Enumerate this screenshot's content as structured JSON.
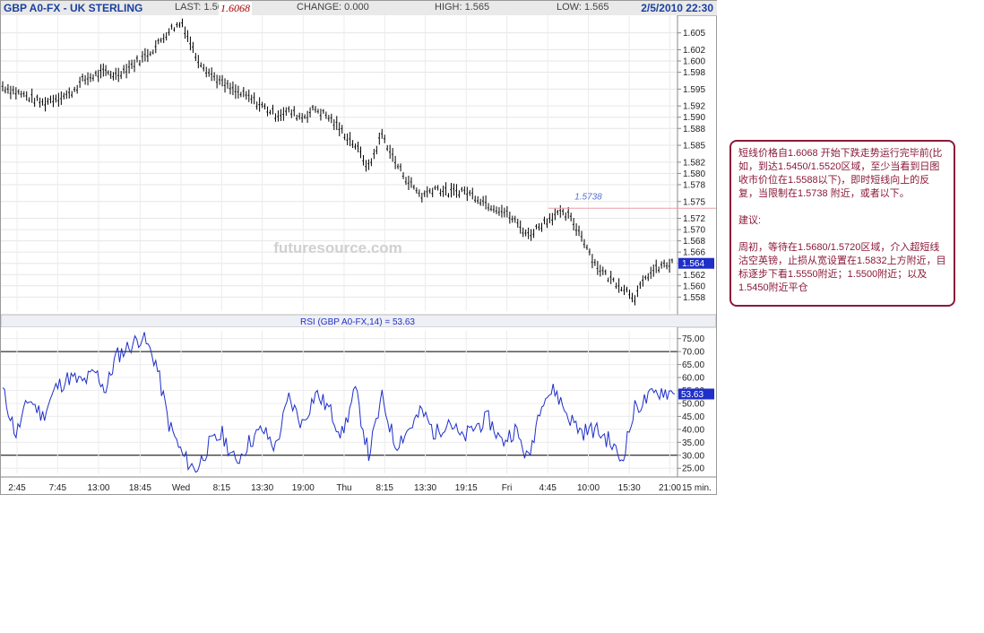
{
  "header": {
    "title": "GBP A0-FX - UK STERLING",
    "last_label": "LAST: 1.56",
    "last_annotation": "1.6068",
    "change_label": "CHANGE: 0.000",
    "high_label": "HIGH: 1.565",
    "low_label": "LOW: 1.565",
    "datetime": "2/5/2010 22:30"
  },
  "watermark": "futuresource.com",
  "price_annotation": "1.5738",
  "last_price_tag": "1.564",
  "rsi_label": "RSI (GBP A0-FX,14) = 53.63",
  "rsi_value_tag": "53.63",
  "interval_label": "15 min.",
  "annotation": {
    "line1": "短线价格自1.6068 开始下跌走势运行完毕前(比如，到达1.5450/1.5520区域，至少当看到日图收市价位在1.5588以下)，即时短线向上的反复，当限制在1.5738 附近，或者以下。",
    "line2": "建议:",
    "line3": "周初，等待在1.5680/1.5720区域，介入超短线沽空英镑，止损从宽设置在1.5832上方附近，目标逐步下看1.5550附近；1.5500附近；以及1.5450附近平仓"
  },
  "colors": {
    "price_bars": "#000000",
    "rsi_line": "#1f2fc8",
    "annotation_border": "#8b1a3a",
    "tag_background": "#1f2fc8"
  },
  "chart_data": [
    {
      "type": "line",
      "title": "GBP A0-FX - UK STERLING",
      "series": [
        {
          "x_index": [
            0,
            4,
            8,
            12,
            16,
            20,
            24,
            28,
            31,
            34,
            38,
            42,
            46,
            50,
            54,
            58,
            62,
            66,
            70,
            74,
            78,
            82,
            86,
            90,
            94,
            98,
            102,
            106,
            110,
            114,
            118,
            122,
            126,
            130,
            134,
            138,
            142,
            146,
            150,
            154,
            158,
            162,
            166,
            170,
            174,
            178,
            182,
            186,
            190,
            194,
            198,
            202
          ],
          "values": [
            1.5955,
            1.5945,
            1.5935,
            1.5925,
            1.5935,
            1.594,
            1.5965,
            1.5975,
            1.598,
            1.5975,
            1.599,
            1.6005,
            1.6025,
            1.6055,
            1.6068,
            1.601,
            1.598,
            1.596,
            1.5945,
            1.5935,
            1.592,
            1.5905,
            1.591,
            1.59,
            1.5915,
            1.59,
            1.5875,
            1.585,
            1.581,
            1.587,
            1.582,
            1.5785,
            1.576,
            1.5775,
            1.5765,
            1.577,
            1.576,
            1.5745,
            1.5735,
            1.5715,
            1.569,
            1.571,
            1.5728,
            1.5725,
            1.569,
            1.564,
            1.5615,
            1.56,
            1.558,
            1.562,
            1.5635,
            1.564
          ]
        }
      ],
      "ylim": [
        1.5555,
        1.6075
      ],
      "y_ticks": [
        1.558,
        1.56,
        1.562,
        1.564,
        1.566,
        1.568,
        1.57,
        1.572,
        1.575,
        1.578,
        1.58,
        1.582,
        1.585,
        1.588,
        1.59,
        1.592,
        1.595,
        1.598,
        1.6,
        1.602,
        1.605
      ],
      "y_tick_labels": [
        "1.558",
        "1.560",
        "1.562",
        "1.564",
        "1.566",
        "1.568",
        "1.570",
        "1.572",
        "1.575",
        "1.578",
        "1.580",
        "1.582",
        "1.585",
        "1.588",
        "1.590",
        "1.592",
        "1.595",
        "1.598",
        "1.600",
        "1.602",
        "1.605"
      ],
      "x_tick_labels": [
        "2:45",
        "7:45",
        "13:00",
        "18:45",
        "Wed",
        "8:15",
        "13:30",
        "19:00",
        "Thu",
        "8:15",
        "13:30",
        "19:15",
        "Fri",
        "4:45",
        "10:00",
        "15:30",
        "21:00"
      ],
      "reference_line": 1.5738,
      "grid": true
    },
    {
      "type": "line",
      "title": "RSI (GBP A0-FX,14) = 53.63",
      "series": [
        {
          "x_index": [
            0,
            4,
            8,
            12,
            16,
            20,
            24,
            28,
            31,
            34,
            38,
            42,
            46,
            50,
            54,
            58,
            62,
            66,
            70,
            74,
            78,
            82,
            86,
            90,
            94,
            98,
            102,
            106,
            110,
            114,
            118,
            122,
            126,
            130,
            134,
            138,
            142,
            146,
            150,
            154,
            158,
            162,
            166,
            170,
            174,
            178,
            182,
            186,
            190,
            194,
            198,
            202
          ],
          "values": [
            55,
            38,
            52,
            45,
            56,
            60,
            58,
            62,
            55,
            68,
            72,
            76,
            66,
            42,
            30,
            24,
            34,
            38,
            27,
            35,
            40,
            33,
            52,
            42,
            54,
            48,
            38,
            55,
            30,
            52,
            34,
            40,
            47,
            38,
            44,
            36,
            41,
            44,
            35,
            40,
            28,
            52,
            55,
            45,
            39,
            40,
            36,
            28,
            48,
            52,
            55,
            53.63
          ]
        }
      ],
      "ylim": [
        23,
        78
      ],
      "y_ticks": [
        25,
        30,
        35,
        40,
        45,
        50,
        55,
        60,
        65,
        70,
        75
      ],
      "y_tick_labels": [
        "25.00",
        "30.00",
        "35.00",
        "40.00",
        "45.00",
        "50.00",
        "55.00",
        "60.00",
        "65.00",
        "70.00",
        "75.00"
      ],
      "reference_levels": [
        70,
        30
      ],
      "grid": true
    }
  ]
}
